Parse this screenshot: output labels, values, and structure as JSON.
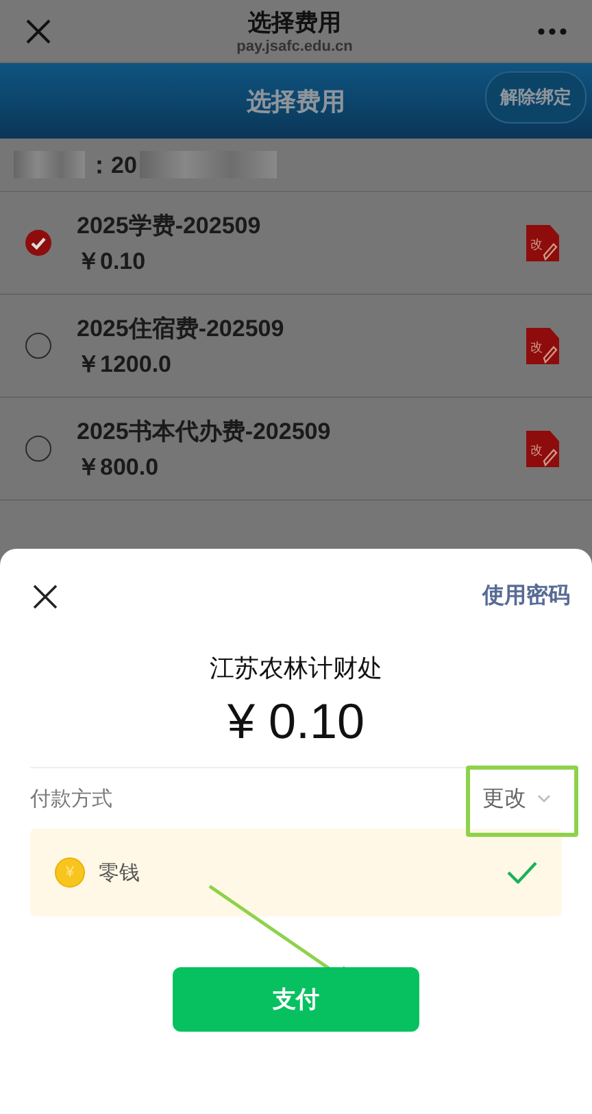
{
  "top_bar": {
    "title": "选择费用",
    "subtitle": "pay.jsafc.edu.cn"
  },
  "header": {
    "title": "选择费用",
    "unbind_button": "解除绑定"
  },
  "student": {
    "id_prefix": "：20"
  },
  "fees": [
    {
      "name": "2025学费-202509",
      "amount": "￥0.10",
      "selected": true,
      "edit_icon": "改"
    },
    {
      "name": "2025住宿费-202509",
      "amount": "￥1200.0",
      "selected": false,
      "edit_icon": "改"
    },
    {
      "name": "2025书本代办费-202509",
      "amount": "￥800.0",
      "selected": false,
      "edit_icon": "改"
    }
  ],
  "sheet": {
    "password_link": "使用密码",
    "merchant": "江苏农林计财处",
    "amount": "¥ 0.10",
    "payment_method_label": "付款方式",
    "change_button": "更改",
    "method": {
      "coin": "¥",
      "name": "零钱",
      "selected": true
    },
    "pay_button": "支付"
  }
}
